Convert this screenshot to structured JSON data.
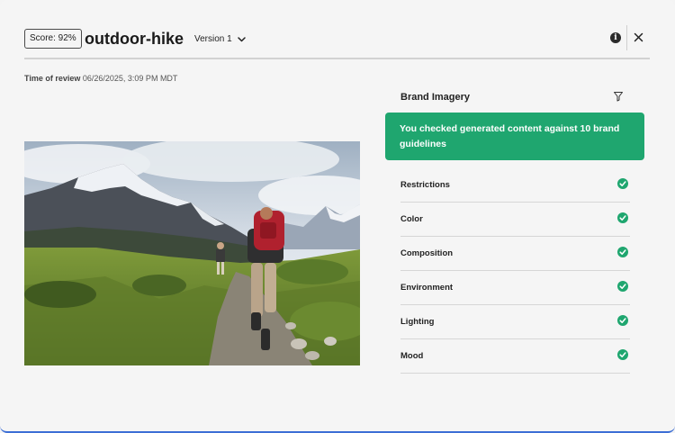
{
  "header": {
    "score_label": "Score: 92%",
    "asset_name": "outdoor-hike",
    "version_label": "Version 1"
  },
  "review": {
    "time_label": "Time of review",
    "time_value": "06/26/2025, 3:09 PM MDT"
  },
  "panel": {
    "title": "Brand Imagery",
    "summary": "You checked generated content against 10 brand guidelines",
    "summary_color": "#1fa66f",
    "check_color": "#1fa66f",
    "guidelines": [
      {
        "label": "Restrictions",
        "status_icon": "check-circle-icon"
      },
      {
        "label": "Color",
        "status_icon": "check-circle-icon"
      },
      {
        "label": "Composition",
        "status_icon": "check-circle-icon"
      },
      {
        "label": "Environment",
        "status_icon": "check-circle-icon"
      },
      {
        "label": "Lighting",
        "status_icon": "check-circle-icon"
      },
      {
        "label": "Mood",
        "status_icon": "check-circle-icon"
      }
    ]
  },
  "icons": {
    "info": "info-icon",
    "close": "close-icon",
    "filter": "filter-icon",
    "chevron": "chevron-down-icon"
  }
}
